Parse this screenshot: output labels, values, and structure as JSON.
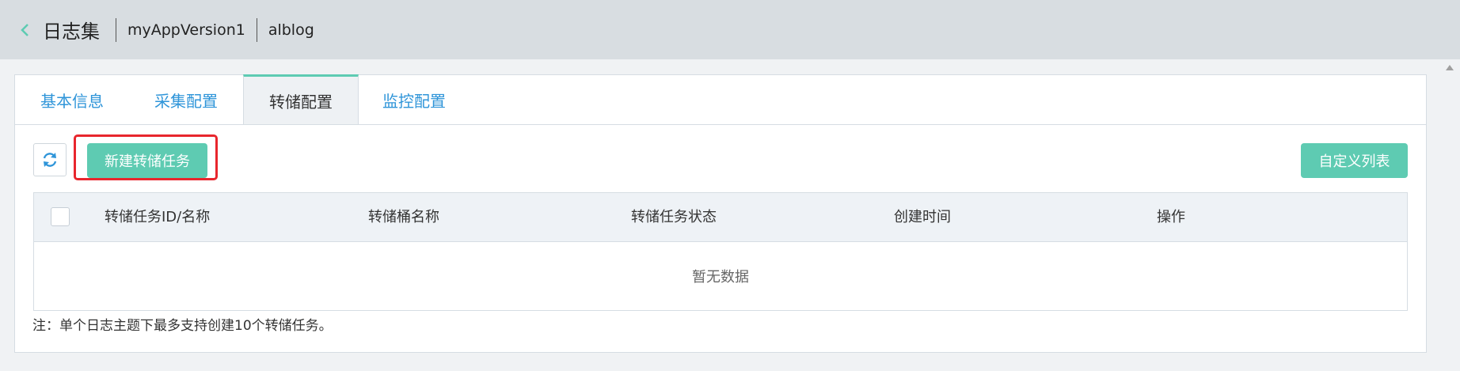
{
  "breadcrumb": {
    "title": "日志集",
    "items": [
      "myAppVersion1",
      "alblog"
    ]
  },
  "tabs": [
    {
      "label": "基本信息",
      "active": false
    },
    {
      "label": "采集配置",
      "active": false
    },
    {
      "label": "转储配置",
      "active": true
    },
    {
      "label": "监控配置",
      "active": false
    }
  ],
  "toolbar": {
    "new_task_label": "新建转储任务",
    "custom_list_label": "自定义列表"
  },
  "table": {
    "columns": [
      "转储任务ID/名称",
      "转储桶名称",
      "转储任务状态",
      "创建时间",
      "操作"
    ],
    "empty_text": "暂无数据"
  },
  "note": "注：单个日志主题下最多支持创建10个转储任务。",
  "colors": {
    "accent": "#5ecbb2",
    "link": "#2f95d9",
    "highlight": "#e8262d"
  }
}
